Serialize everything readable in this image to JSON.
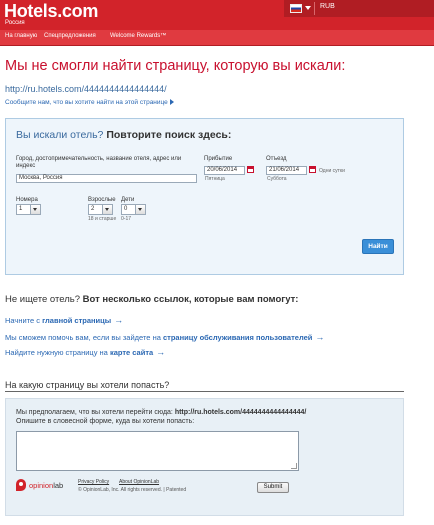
{
  "header": {
    "logo": "Hotels.com",
    "logo_sub": "Россия",
    "currency": "RUB",
    "colors": {
      "brand_red": "#d2232a",
      "link_blue": "#2b68b3",
      "button_blue": "#3a8fd8"
    }
  },
  "nav": {
    "items": [
      "На главную",
      "Спецпредложения",
      "Welcome Rewards™"
    ]
  },
  "page": {
    "title": "Мы не смогли найти страницу, которую вы искали:",
    "url": "http://ru.hotels.com/4444444444444444/",
    "report_link": "Сообщите нам, что вы хотите найти на этой странице"
  },
  "search": {
    "heading_lead": "Вы искали отель?",
    "heading_bold": "Повторите поиск здесь:",
    "destination_label": "Город, достопримечательность, название отеля, адрес или индекс",
    "destination_value": "Москва, Россия",
    "checkin_label": "Прибытие",
    "checkin_value": "20/06/2014",
    "checkin_day": "Пятница",
    "checkout_label": "Отъезд",
    "checkout_value": "21/06/2014",
    "checkout_day": "Суббота",
    "nights": "Одни сутки",
    "rooms_label": "Номера",
    "rooms_value": "1",
    "adults_label": "Взрослые",
    "adults_value": "2",
    "adults_hint": "18 и старше",
    "children_label": "Дети",
    "children_value": "0",
    "children_hint": "0-17",
    "find_button": "Найти"
  },
  "help": {
    "lead": "Не ищете отель?",
    "bold": "Вот несколько ссылок, которые вам помогут:",
    "links": [
      {
        "text": "Начните с ",
        "bold": "главной страницы"
      },
      {
        "text": "Мы сможем помочь вам, если вы зайдете на ",
        "bold": "страницу обслуживания пользователей"
      },
      {
        "text": "Найдите нужную страницу на ",
        "bold": "карте сайта"
      }
    ]
  },
  "feedback": {
    "question": "На какую страницу вы хотели попасть?",
    "prompt_lead": "Мы предполагаем, что вы хотели перейти сюда:",
    "prompt_url": "http://ru.hotels.com/4444444444444444/",
    "prompt_line2": "Опишите в словесной форме, куда вы хотели попасть:",
    "brand_a": "opinion",
    "brand_b": "lab",
    "privacy": "Privacy Policy",
    "about": "About OpinionLab",
    "copyright": "© OpinionLab, Inc. All rights reserved. | Patented",
    "submit": "Submit"
  }
}
